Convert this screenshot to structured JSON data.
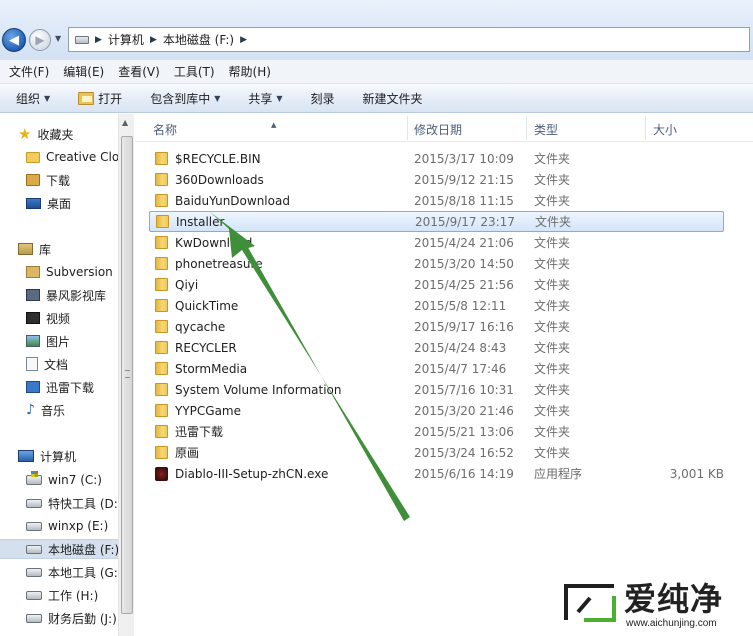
{
  "address": {
    "path": [
      "计算机",
      "本地磁盘 (F:)"
    ]
  },
  "menu": [
    "文件(F)",
    "编辑(E)",
    "查看(V)",
    "工具(T)",
    "帮助(H)"
  ],
  "toolbar": {
    "organize": "组织",
    "open": "打开",
    "include_library": "包含到库中",
    "share": "共享",
    "burn": "刻录",
    "new_folder": "新建文件夹"
  },
  "nav": {
    "favorites": {
      "label": "收藏夹",
      "items": [
        "Creative Cloud",
        "下载",
        "桌面"
      ]
    },
    "libraries": {
      "label": "库",
      "items": [
        "Subversion",
        "暴风影视库",
        "视频",
        "图片",
        "文档",
        "迅雷下载",
        "音乐"
      ]
    },
    "computer": {
      "label": "计算机",
      "drives": [
        "win7 (C:)",
        "特快工具 (D:)",
        "winxp (E:)",
        "本地磁盘 (F:)",
        "本地工具 (G:)",
        "工作 (H:)",
        "财务后勤 (J:)"
      ]
    }
  },
  "columns": {
    "name": "名称",
    "date": "修改日期",
    "type": "类型",
    "size": "大小"
  },
  "files": [
    {
      "name": "$RECYCLE.BIN",
      "date": "2015/3/17 10:09",
      "type": "文件夹",
      "size": ""
    },
    {
      "name": "360Downloads",
      "date": "2015/9/12 21:15",
      "type": "文件夹",
      "size": ""
    },
    {
      "name": "BaiduYunDownload",
      "date": "2015/8/18 11:15",
      "type": "文件夹",
      "size": ""
    },
    {
      "name": "Installer",
      "date": "2015/9/17 23:17",
      "type": "文件夹",
      "size": ""
    },
    {
      "name": "KwDownload",
      "date": "2015/4/24 21:06",
      "type": "文件夹",
      "size": ""
    },
    {
      "name": "phonetreasure",
      "date": "2015/3/20 14:50",
      "type": "文件夹",
      "size": ""
    },
    {
      "name": "Qiyi",
      "date": "2015/4/25 21:56",
      "type": "文件夹",
      "size": ""
    },
    {
      "name": "QuickTime",
      "date": "2015/5/8 12:11",
      "type": "文件夹",
      "size": ""
    },
    {
      "name": "qycache",
      "date": "2015/9/17 16:16",
      "type": "文件夹",
      "size": ""
    },
    {
      "name": "RECYCLER",
      "date": "2015/4/24 8:43",
      "type": "文件夹",
      "size": ""
    },
    {
      "name": "StormMedia",
      "date": "2015/4/7 17:46",
      "type": "文件夹",
      "size": ""
    },
    {
      "name": "System Volume Information",
      "date": "2015/7/16 10:31",
      "type": "文件夹",
      "size": ""
    },
    {
      "name": "YYPCGame",
      "date": "2015/3/20 21:46",
      "type": "文件夹",
      "size": ""
    },
    {
      "name": "迅雷下载",
      "date": "2015/5/21 13:06",
      "type": "文件夹",
      "size": ""
    },
    {
      "name": "原画",
      "date": "2015/3/24 16:52",
      "type": "文件夹",
      "size": ""
    },
    {
      "name": "Diablo-III-Setup-zhCN.exe",
      "date": "2015/6/16 14:19",
      "type": "应用程序",
      "size": "3,001 KB"
    }
  ],
  "watermark": {
    "name": "爱纯净",
    "url": "www.aichunjing.com"
  },
  "colors": {
    "selection": "#d3e5fa",
    "arrow": "#3f8f3a"
  }
}
